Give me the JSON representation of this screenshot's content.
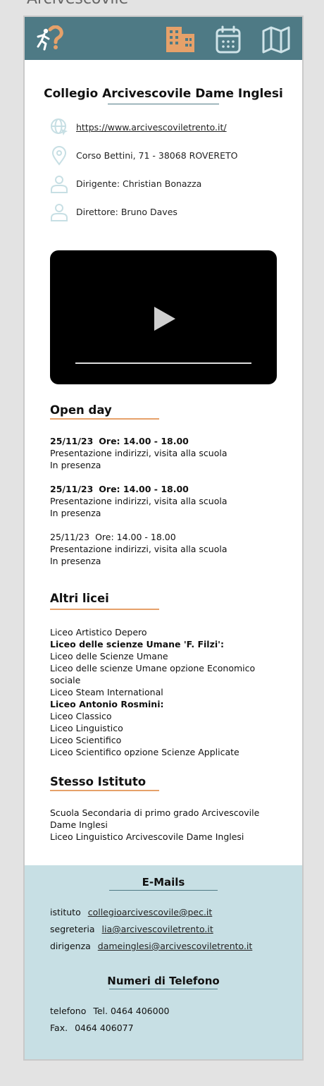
{
  "page_label": "Arcivescovile",
  "colors": {
    "topbar": "#4e7a85",
    "accent": "#e6a16a",
    "footer": "#c7dfe4"
  },
  "nav": {
    "icons": [
      "running-person-question-logo",
      "building-icon",
      "calendar-icon",
      "map-icon"
    ]
  },
  "school": {
    "title": "Collegio Arcivescovile Dame Inglesi",
    "website": "https://www.arcivescoviletrento.it/",
    "address": "Corso Bettini, 71 - 38068 ROVERETO",
    "dirigente": "Dirigente: Christian Bonazza",
    "direttore": "Direttore: Bruno Daves"
  },
  "open_day": {
    "heading": "Open day",
    "events": [
      {
        "date": "25/11/23",
        "time": "Ore: 14.00 - 18.00",
        "desc": "Presentazione indirizzi, visita alla scuola",
        "mode": "In presenza"
      },
      {
        "date": "25/11/23",
        "time": "Ore: 14.00 - 18.00",
        "desc": "Presentazione indirizzi, visita alla scuola",
        "mode": "In presenza"
      },
      {
        "date": "25/11/23",
        "time": "Ore: 14.00 - 18.00",
        "desc": "Presentazione indirizzi, visita alla scuola",
        "mode": "In presenza"
      }
    ]
  },
  "altri_licei": {
    "heading": "Altri licei",
    "items": [
      "Liceo Artistico Depero",
      "Liceo delle scienze Umane 'F. Filzi':",
      "Liceo delle Scienze Umane",
      "Liceo delle scienze Umane opzione Economico sociale",
      "Liceo Steam International",
      "Liceo Antonio Rosmini:",
      "Liceo Classico",
      "Liceo Linguistico",
      "Liceo Scientifico",
      "Liceo Scientifico opzione Scienze Applicate"
    ]
  },
  "stesso_istituto": {
    "heading": "Stesso Istituto",
    "items": [
      "Scuola Secondaria di primo grado Arcivescovile Dame Inglesi",
      "Liceo Linguistico Arcivescovile Dame Inglesi"
    ]
  },
  "emails": {
    "heading": "E-Mails",
    "rows": [
      {
        "label": "istituto",
        "value": "collegioarcivescovile@pec.it"
      },
      {
        "label": "segreteria",
        "value": "lia@arcivescoviletrento.it"
      },
      {
        "label": "dirigenza",
        "value": "dameinglesi@arcivescoviletrento.it"
      }
    ]
  },
  "phones": {
    "heading": "Numeri di Telefono",
    "rows": [
      {
        "label": "telefono",
        "value": "Tel. 0464 406000"
      },
      {
        "label": "Fax.",
        "value": "0464 406077"
      }
    ]
  }
}
